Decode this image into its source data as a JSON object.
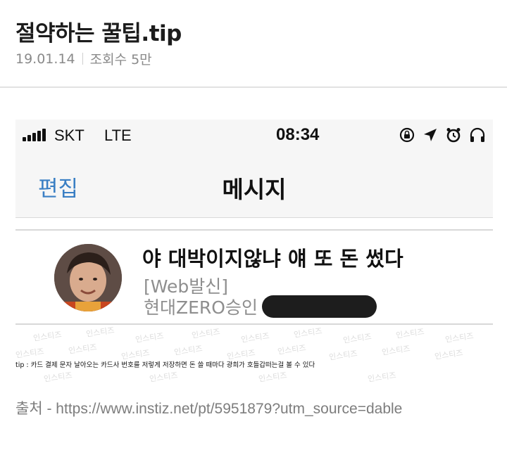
{
  "post": {
    "title": "절약하는 꿀팁.tip",
    "date": "19.01.14",
    "views": "조회수 5만"
  },
  "screenshot": {
    "status_bar": {
      "carrier": "SKT",
      "network": "LTE",
      "time": "08:34",
      "icons": [
        "rotation-lock-icon",
        "location-arrow-icon",
        "alarm-icon",
        "headphones-icon"
      ]
    },
    "nav": {
      "edit_label": "편집",
      "title": "메시지"
    },
    "message": {
      "sender_title": "야 대박이지않냐 얘 또 돈 썼다",
      "line2": "[Web발신]",
      "line3": "현대ZERO승인"
    },
    "watermark_text": "인스티즈",
    "caption": "tip : 카드 결제 문자 날아오는 카드사 번호를 저렇게 저장하면 돈 쓸 때마다 광희가 호들갑떠는걸 볼 수 있다"
  },
  "source": {
    "text": "출처 - https://www.instiz.net/pt/5951879?utm_source=dable"
  },
  "colors": {
    "accent_blue": "#3a7fc4",
    "meta_gray": "#8a8a8a",
    "bar_bg": "#f6f6f6"
  }
}
